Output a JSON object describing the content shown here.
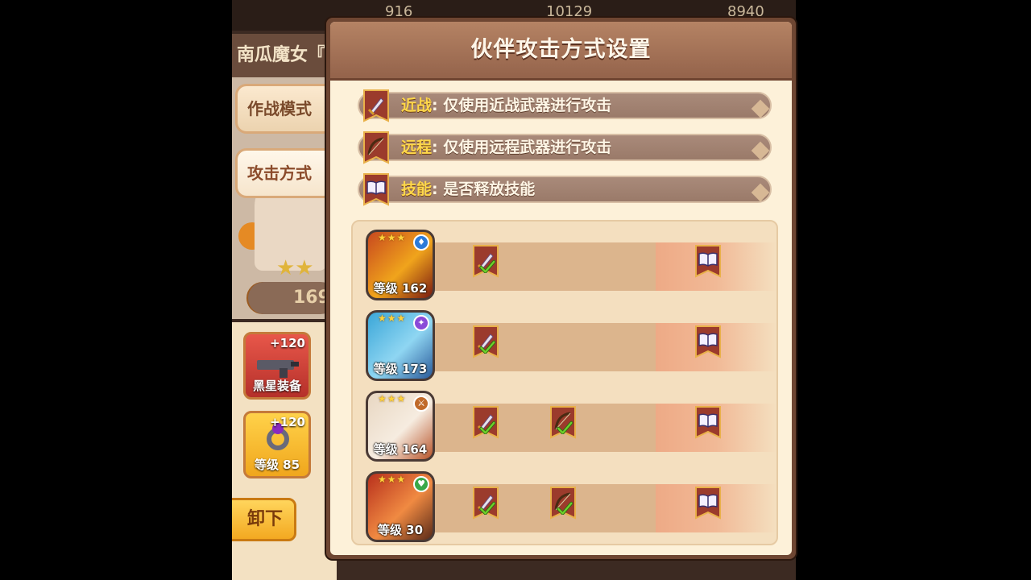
{
  "background": {
    "topbar_values": [
      "916",
      "10129",
      "8940"
    ],
    "hero_title": "南瓜魔女『",
    "tabs": [
      "作战模式",
      "攻击方式"
    ],
    "power_value": "169",
    "equipment": [
      {
        "plus": "+120",
        "label": "黑星装备"
      },
      {
        "plus": "+120",
        "label": "等级 85"
      }
    ],
    "unload_label": "卸下"
  },
  "dialog": {
    "title": "伙伴攻击方式设置",
    "legend": [
      {
        "icon": "sword-icon",
        "keyword": "近战",
        "colon": ":",
        "description": "仅使用近战武器进行攻击"
      },
      {
        "icon": "bow-icon",
        "keyword": "远程",
        "colon": ":",
        "description": "仅使用远程武器进行攻击"
      },
      {
        "icon": "skill-book-icon",
        "keyword": "技能",
        "colon": ":",
        "description": "是否释放技能"
      }
    ],
    "partners": [
      {
        "level_label": "等级 162",
        "class_icon": "shield-icon",
        "melee": true,
        "ranged": false,
        "skill": false
      },
      {
        "level_label": "等级 173",
        "class_icon": "magic-icon",
        "melee": true,
        "ranged": false,
        "skill": false
      },
      {
        "level_label": "等级 164",
        "class_icon": "sword-icon",
        "melee": false,
        "ranged": true,
        "skill": false
      },
      {
        "level_label": "等级 30",
        "class_icon": "heal-icon",
        "melee": false,
        "ranged": true,
        "skill": false
      }
    ]
  },
  "colors": {
    "keyword": "#ffd84a",
    "banner": "#9b3b2c",
    "check": "#6ed02b"
  }
}
